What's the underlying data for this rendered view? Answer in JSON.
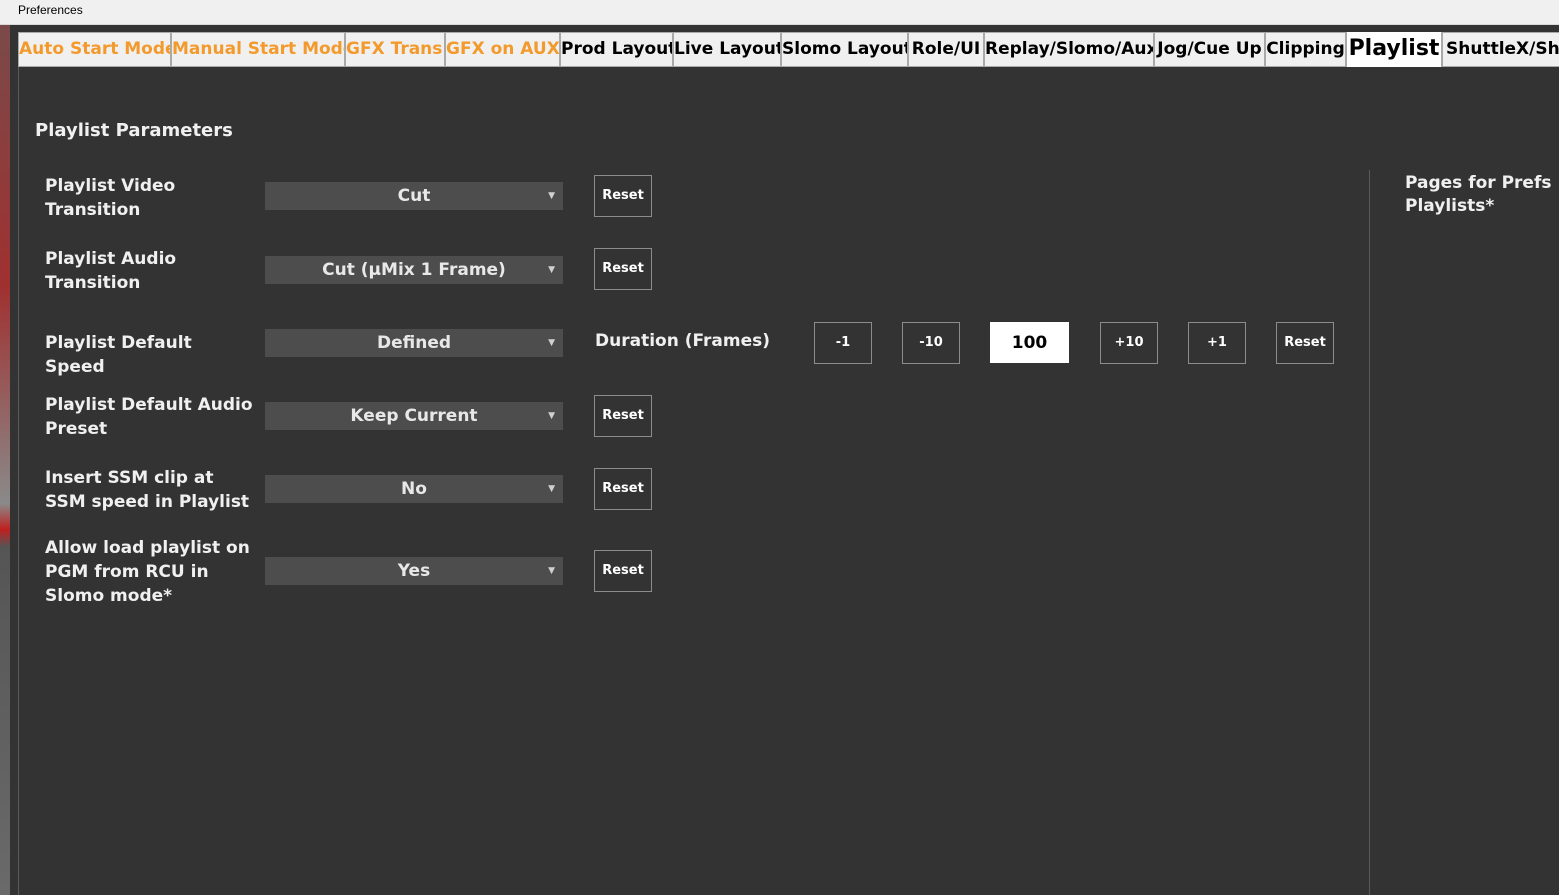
{
  "window": {
    "title": "Preferences"
  },
  "tabs": [
    {
      "label": "Auto Start Mode",
      "style": "orange"
    },
    {
      "label": "Manual Start Mode",
      "style": "orange"
    },
    {
      "label": "GFX Trans.",
      "style": "orange"
    },
    {
      "label": "GFX on AUX",
      "style": "orange"
    },
    {
      "label": "Prod Layout",
      "style": "normal"
    },
    {
      "label": "Live Layout",
      "style": "normal"
    },
    {
      "label": "Slomo Layout",
      "style": "normal"
    },
    {
      "label": "Role/UI",
      "style": "normal"
    },
    {
      "label": "Replay/Slomo/Aux",
      "style": "normal"
    },
    {
      "label": "Jog/Cue Up",
      "style": "normal"
    },
    {
      "label": "Clipping",
      "style": "normal"
    },
    {
      "label": "Playlist",
      "style": "active"
    },
    {
      "label": "ShuttleX/Shor",
      "style": "normal"
    }
  ],
  "section": {
    "title": "Playlist Parameters"
  },
  "params": [
    {
      "label": "Playlist Video Transition",
      "value": "Cut",
      "reset": "Reset"
    },
    {
      "label": "Playlist Audio Transition",
      "value": "Cut (µMix 1 Frame)",
      "reset": "Reset"
    },
    {
      "label": "Playlist Default Speed",
      "value": "Defined"
    },
    {
      "label": "Playlist Default Audio Preset",
      "value": "Keep Current",
      "reset": "Reset"
    },
    {
      "label": "Insert SSM clip at SSM speed in Playlist",
      "value": "No",
      "reset": "Reset"
    },
    {
      "label": "Allow load playlist on PGM from RCU in Slomo mode*",
      "value": "Yes",
      "reset": "Reset"
    }
  ],
  "duration": {
    "label": "Duration (Frames)",
    "minus1": "-1",
    "minus10": "-10",
    "value": "100",
    "plus10": "+10",
    "plus1": "+1",
    "reset": "Reset"
  },
  "side": {
    "title": "Pages for Prefs Playlists*"
  },
  "colors": {
    "accent_orange": "#f39a2c",
    "background": "#333333",
    "combo": "#4d4d4d"
  },
  "icons": {
    "caret": "dropdown-caret-icon"
  }
}
